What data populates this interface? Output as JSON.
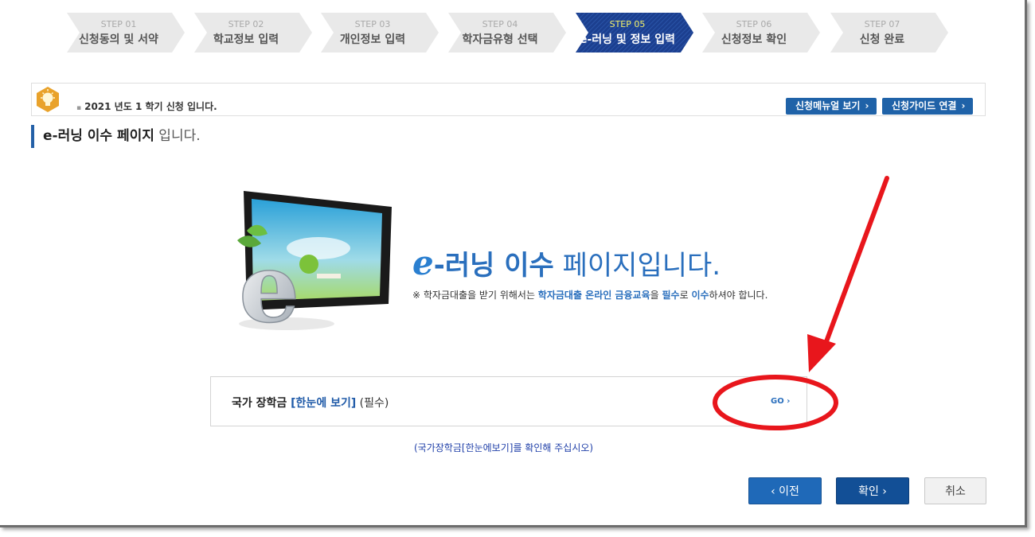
{
  "steps": [
    {
      "num": "STEP 01",
      "label": "신청동의 및 서약",
      "active": false
    },
    {
      "num": "STEP 02",
      "label": "학교정보 입력",
      "active": false
    },
    {
      "num": "STEP 03",
      "label": "개인정보 입력",
      "active": false
    },
    {
      "num": "STEP 04",
      "label": "학자금유형 선택",
      "active": false
    },
    {
      "num": "STEP 05",
      "label": "e-러닝 및 정보 입력",
      "active": true
    },
    {
      "num": "STEP 06",
      "label": "신청정보 확인",
      "active": false
    },
    {
      "num": "STEP 07",
      "label": "신청 완료",
      "active": false
    }
  ],
  "info": {
    "semester": "2021 년도 1 학기 신청 입니다.",
    "manual_button": "신청메뉴얼 보기",
    "guide_button": "신청가이드 연결"
  },
  "section": {
    "title_bold": "e-러닝 이수 페이지",
    "title_normal": " 입니다."
  },
  "hero": {
    "title_e": "e",
    "title_mid": "-러닝 이수",
    "title_rest": " 페이지입니다.",
    "note_prefix": "※ 학자금대출을 받기 위해서는 ",
    "note_hl1": "학자금대출 온라인 금융교육",
    "note_mid1": "을 ",
    "note_hl2": "필수",
    "note_mid2": "로 ",
    "note_hl3": "이수",
    "note_suffix": "하셔야 합니다."
  },
  "item": {
    "name": "국가 장학금 ",
    "link": "[한눈에 보기]",
    "required": " (필수)",
    "go": "GO ›"
  },
  "confirm_note": "(국가장학금[한눈에보기]를 확인해 주십시오)",
  "buttons": {
    "prev": "‹  이전",
    "ok": "확인  ›",
    "cancel": "취소"
  },
  "colors": {
    "primary": "#1f62a8",
    "step_active": "#1c3f8f",
    "step_inactive": "#e9e9e9",
    "annotation": "#e8161c"
  }
}
